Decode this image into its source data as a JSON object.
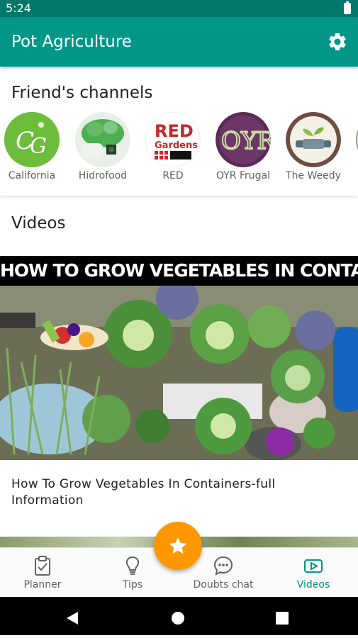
{
  "status_bar": {
    "time": "5:24"
  },
  "app_bar": {
    "title": "Pot Agriculture"
  },
  "friends": {
    "title": "Friend's channels",
    "channels": [
      {
        "name": "California"
      },
      {
        "name": "Hidrofood"
      },
      {
        "name": "RED"
      },
      {
        "name": "OYR Frugal"
      },
      {
        "name": "The Weedy"
      }
    ],
    "red_logo_text": [
      "RED",
      "Gardens"
    ],
    "oyr_logo_text": "OYR"
  },
  "videos": {
    "title": "Videos",
    "items": [
      {
        "thumbnail_text": "HOW TO GROW VEGETABLES IN CONTAINERS",
        "caption": "How To Grow Vegetables In Containers-full Information"
      }
    ]
  },
  "bottom_nav": {
    "items": [
      {
        "label": "Planner",
        "icon": "clipboard-check-icon"
      },
      {
        "label": "Tips",
        "icon": "lightbulb-icon"
      },
      {
        "label": "Doubts chat",
        "icon": "chat-icon"
      },
      {
        "label": "Videos",
        "icon": "video-icon"
      }
    ],
    "active": "Videos"
  },
  "fab": {
    "icon": "star-icon"
  },
  "colors": {
    "primary": "#009688",
    "primary_dark": "#00796b",
    "accent": "#ff9800"
  }
}
